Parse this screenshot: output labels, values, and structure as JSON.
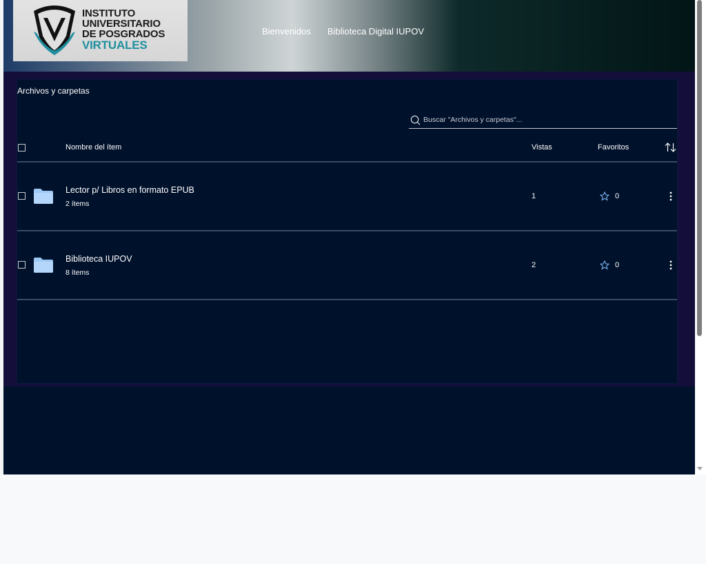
{
  "header": {
    "logo": {
      "line1": "INSTITUTO",
      "line2": "UNIVERSITARIO",
      "line3": "DE POSGRADOS",
      "line4": "VIRTUALES"
    },
    "nav": [
      {
        "label": "Bienvenidos"
      },
      {
        "label": "Biblioteca Digital IUPOV"
      }
    ]
  },
  "panel": {
    "title": "Archivos y carpetas",
    "search": {
      "placeholder": "Buscar \"Archivos y carpetas\"...",
      "value": ""
    },
    "columns": {
      "name": "Nombre del ítem",
      "views": "Vistas",
      "favorites": "Favoritos"
    },
    "rows": [
      {
        "name": "Lector p/ Libros en formato EPUB",
        "subtitle": "2 ítems",
        "views": "1",
        "favorites": "0"
      },
      {
        "name": "Biblioteca IUPOV",
        "subtitle": "8 ítems",
        "views": "2",
        "favorites": "0"
      }
    ]
  },
  "colors": {
    "background": "#00112b",
    "accent": "#1f8e9e",
    "folder": "#9ec9f5",
    "star": "#7fb1f0"
  },
  "icons": {
    "search": "search-icon",
    "folder": "folder-icon",
    "star": "star-icon",
    "sort": "sort-icon",
    "more": "kebab-menu-icon"
  }
}
